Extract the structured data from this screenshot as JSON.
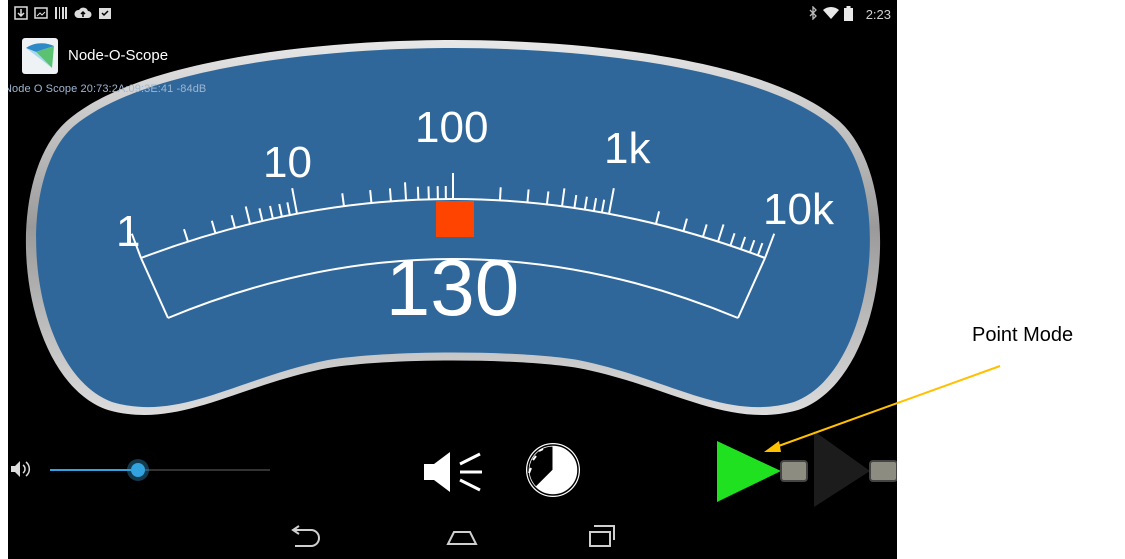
{
  "status": {
    "clock": "2:23",
    "left_icons": [
      "download-icon",
      "image-icon",
      "barcode-icon",
      "cloud-upload-icon",
      "clipboard-check-icon"
    ],
    "right_icons": [
      "bluetooth-icon",
      "wifi-icon",
      "battery-icon"
    ]
  },
  "app": {
    "title": "Node-O-Scope"
  },
  "device_info": "Node O Scope  20:73:2A:09:3E:41 -84dB",
  "meter": {
    "scale_labels": [
      "1",
      "10",
      "100",
      "1k",
      "10k"
    ],
    "reading": "130",
    "indicator_color": "#ff4400",
    "panel_color": "#2f679a"
  },
  "controls": {
    "volume": {
      "level": 0.4,
      "icon": "volume-icon"
    },
    "buttons": [
      "speaker-icon",
      "clock-icon",
      "point-mode-icon",
      "stream-mode-icon"
    ]
  },
  "navbar": {
    "buttons": [
      "back-icon",
      "home-icon",
      "recents-icon"
    ]
  },
  "annotation": {
    "label": "Point Mode",
    "arrow_color": "#ffc000"
  }
}
